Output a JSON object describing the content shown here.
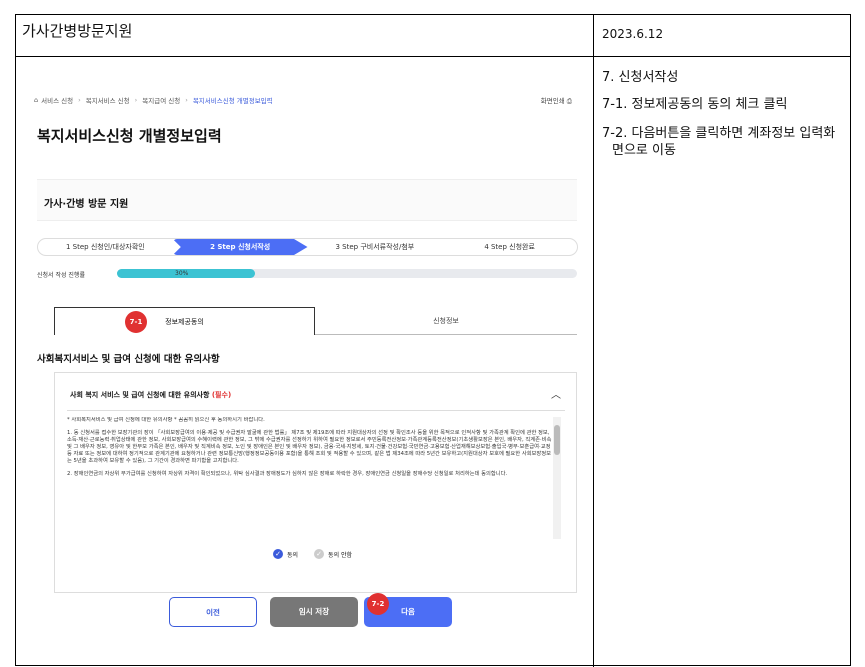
{
  "doc": {
    "title": "가사간병방문지원",
    "date": "2023.6.12"
  },
  "notes": [
    "7. 신청서작성",
    "7-1. 정보제공동의 동의 체크 클릭",
    "7-2. 다음버튼을 클릭하면 계좌정보 입력화면으로 이동"
  ],
  "breadcrumb": [
    "서비스 신청",
    "복지서비스 신청",
    "복지급여 신청",
    "복지서비스신청 개별정보입력"
  ],
  "print_label": "화면인쇄",
  "page_title": "복지서비스신청 개별정보입력",
  "service_name": "가사·간병 방문 지원",
  "steps": [
    "1 Step 신청인/대상자확인",
    "2 Step 신청서작성",
    "3 Step 구비서류작성/첨부",
    "4 Step 신청완료"
  ],
  "active_step": 1,
  "progress": {
    "label": "신청서 작성 진행률",
    "percent": 30,
    "text": "30%"
  },
  "tabs": [
    "정보제공동의",
    "신청정보"
  ],
  "badges": [
    "7-1",
    "7-2"
  ],
  "section_title": "사회복지서비스 및 급여 신청에 대한 유의사항",
  "panel": {
    "title": "사회 복지 서비스 및 급여 신청에 대한 유의사항",
    "required": "(필수)",
    "terms": [
      "* 사회복지서비스 및 급여 신청에 대한 유의사항 * 꼼꼼히 읽으신 후 동의하시기 바랍니다.",
      "1. 동 신청서를 접수한 보장기관의 장이 「사회보장급여의 이용·제공 및 수급권자 발굴에 관한 법률」 제7조 및 제19조에 따라 지원대상자의 선정 및 확인조사 등을 위한 목적으로 인적사항 및 가족관계 확인에 관한 정보, 소득·재산·근로능력·취업상태에 관한 정보, 사회보장급여의 수혜이력에 관한 정보, 그 밖에 수급권자를 선정하기 위하여 필요한 정보로서 주민등록전산정보·가족관계등록전산정보(기초생활보장은 본인, 배우자, 직계존·비속 및 그 배우자 정보, 영유아 및 한부모 가족은 본인, 배우자 및 직계비속 정보, 노인 및 장애인은 본인 및 배우자 정보), 금융·국세·지방세, 토지·건물·건강보험·국민연금·고용보험·산업재해보상보험·출입국·병무·보훈급여·교정 등 자료 또는 정보에 대하여 정기적으로 관계기관에 요청하거나 관련 정보통신망(행정정보공동이용 포함)을 통해 조회 및 적용할 수 있으며, 같은 법 제34조에 따라 5년간 보유하고(지원대상자 보호에 필요한 사회보장정보는 5년을 초과하여 보유할 수 있음), 그 기간이 경과하면 파기함을 고지합니다.",
      "2. 장애인연금의 자상위 부가급여를 신청하여 자상위 자격이 확인되었으나, 위탁 심사결과 장애정도가 심하지 않은 장애로 하락한 경우, 장애인연금 신청일을 장애수당 신청일로 처리하는데 동의합니다."
    ],
    "agree": "동의",
    "disagree": "동의 안함"
  },
  "buttons": {
    "prev": "이전",
    "temp": "임시 저장",
    "next": "다음"
  }
}
